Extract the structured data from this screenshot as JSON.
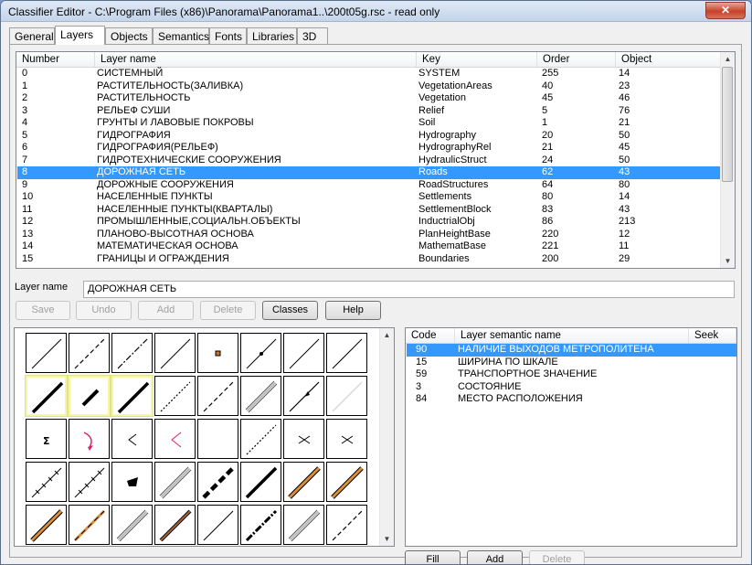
{
  "window": {
    "title": "Classifier Editor - C:\\Program Files (x86)\\Panorama\\Panorama1..\\200t05g.rsc - read only",
    "close_glyph": "✕"
  },
  "tabs": [
    {
      "label": "General"
    },
    {
      "label": "Layers"
    },
    {
      "label": "Objects"
    },
    {
      "label": "Semantics"
    },
    {
      "label": "Fonts"
    },
    {
      "label": "Libraries"
    },
    {
      "label": "3D"
    }
  ],
  "layers_table": {
    "columns": [
      "Number",
      "Layer name",
      "Key",
      "Order",
      "Object"
    ],
    "selected_index": 8,
    "rows": [
      {
        "number": "0",
        "name": "СИСТЕМНЫЙ",
        "key": "SYSTEM",
        "order": "255",
        "object": "14"
      },
      {
        "number": "1",
        "name": "РАСТИТЕЛЬНОСТЬ(ЗАЛИВКА)",
        "key": "VegetationAreas",
        "order": "40",
        "object": "23"
      },
      {
        "number": "2",
        "name": "РАСТИТЕЛЬНОСТЬ",
        "key": "Vegetation",
        "order": "45",
        "object": "46"
      },
      {
        "number": "3",
        "name": "РЕЛЬЕФ СУШИ",
        "key": "Relief",
        "order": "5",
        "object": "76"
      },
      {
        "number": "4",
        "name": "ГРУНТЫ И ЛАВОВЫЕ ПОКРОВЫ",
        "key": "Soil",
        "order": "1",
        "object": "21"
      },
      {
        "number": "5",
        "name": "ГИДРОГРАФИЯ",
        "key": "Hydrography",
        "order": "20",
        "object": "50"
      },
      {
        "number": "6",
        "name": "ГИДРОГРАФИЯ(РЕЛЬЕФ)",
        "key": "HydrographyRel",
        "order": "21",
        "object": "45"
      },
      {
        "number": "7",
        "name": "ГИДРОТЕХНИЧЕСКИЕ СООРУЖЕНИЯ",
        "key": "HydraulicStruct",
        "order": "24",
        "object": "50"
      },
      {
        "number": "8",
        "name": "ДОРОЖНАЯ СЕТЬ",
        "key": "Roads",
        "order": "62",
        "object": "43"
      },
      {
        "number": "9",
        "name": "ДОРОЖНЫЕ СООРУЖЕНИЯ",
        "key": "RoadStructures",
        "order": "64",
        "object": "80"
      },
      {
        "number": "10",
        "name": "НАСЕЛЕННЫЕ ПУНКТЫ",
        "key": "Settlements",
        "order": "80",
        "object": "14"
      },
      {
        "number": "11",
        "name": "НАСЕЛЕННЫЕ ПУНКТЫ(КВАРТАЛЫ)",
        "key": "SettlementBlock",
        "order": "83",
        "object": "43"
      },
      {
        "number": "12",
        "name": "ПРОМЫШЛЕННЫЕ,СОЦИАЛЬН.ОБЪЕКТЫ",
        "key": "InductrialObj",
        "order": "86",
        "object": "213"
      },
      {
        "number": "13",
        "name": "ПЛАНОВО-ВЫСОТНАЯ ОСНОВА",
        "key": "PlanHeightBase",
        "order": "220",
        "object": "12"
      },
      {
        "number": "14",
        "name": "МАТЕМАТИЧЕСКАЯ ОСНОВА",
        "key": "MathematBase",
        "order": "221",
        "object": "11"
      },
      {
        "number": "15",
        "name": "ГРАНИЦЫ И ОГРАЖДЕНИЯ",
        "key": "Boundaries",
        "order": "200",
        "object": "29"
      }
    ]
  },
  "layer_name": {
    "label": "Layer name",
    "value": "ДОРОЖНАЯ СЕТЬ"
  },
  "actions": {
    "save": "Save",
    "undo": "Undo",
    "add": "Add",
    "delete": "Delete",
    "classes": "Classes",
    "help": "Help"
  },
  "semantics_table": {
    "columns": [
      "Code",
      "Layer semantic name",
      "Seek"
    ],
    "selected_index": 0,
    "rows": [
      {
        "code": "90",
        "name": "НАЛИЧИЕ ВЫХОДОВ МЕТРОПОЛИТЕНА"
      },
      {
        "code": "15",
        "name": "ШИРИНА ПО ШКАЛЕ"
      },
      {
        "code": "59",
        "name": "ТРАНСПОРТНОЕ ЗНАЧЕНИЕ"
      },
      {
        "code": "3",
        "name": "СОСТОЯНИЕ"
      },
      {
        "code": "84",
        "name": "МЕСТО РАСПОЛОЖЕНИЯ"
      }
    ]
  },
  "semantic_actions": {
    "fill": "Fill",
    "add": "Add",
    "delete": "Delete"
  },
  "scroll_glyphs": {
    "up": "▲",
    "down": "▼"
  },
  "colors": {
    "selection": "#3399ff",
    "highlight_tile": "#f7f7a0",
    "orange_line": "#d9903a",
    "pink_symbol": "#e0206a"
  },
  "symbols": [
    {
      "name": "thin-line-symbol"
    },
    {
      "name": "dashed-line-symbol"
    },
    {
      "name": "dash-dot-line-symbol"
    },
    {
      "name": "thin-line-symbol"
    },
    {
      "name": "point-marker-symbol"
    },
    {
      "name": "line-with-dots-symbol"
    },
    {
      "name": "thin-line-symbol"
    },
    {
      "name": "thin-line-symbol"
    },
    {
      "name": "thick-line-symbol"
    },
    {
      "name": "short-thick-line-symbol"
    },
    {
      "name": "thick-line-symbol"
    },
    {
      "name": "dotted-line-symbol"
    },
    {
      "name": "dashed-line-symbol"
    },
    {
      "name": "double-line-symbol"
    },
    {
      "name": "line-with-arrows-symbol"
    },
    {
      "name": "faint-line-symbol"
    },
    {
      "name": "bridge-symbol"
    },
    {
      "name": "pink-arrow-symbol"
    },
    {
      "name": "chevron-symbol"
    },
    {
      "name": "pink-chevron-symbol"
    },
    {
      "name": "empty-symbol"
    },
    {
      "name": "dotted-line-symbol"
    },
    {
      "name": "cross-symbol"
    },
    {
      "name": "cross-symbol"
    },
    {
      "name": "ticked-line-symbol"
    },
    {
      "name": "ticked-line-symbol"
    },
    {
      "name": "flag-symbol"
    },
    {
      "name": "double-line-symbol"
    },
    {
      "name": "bold-dashed-line-symbol"
    },
    {
      "name": "thick-line-symbol"
    },
    {
      "name": "orange-road-symbol"
    },
    {
      "name": "orange-road-symbol"
    },
    {
      "name": "orange-road-symbol"
    },
    {
      "name": "orange-dashed-road-symbol"
    },
    {
      "name": "double-line-symbol"
    },
    {
      "name": "brown-road-symbol"
    },
    {
      "name": "thin-line-symbol"
    },
    {
      "name": "mixed-dash-symbol"
    },
    {
      "name": "double-line-symbol"
    },
    {
      "name": "dashed-line-symbol"
    }
  ]
}
